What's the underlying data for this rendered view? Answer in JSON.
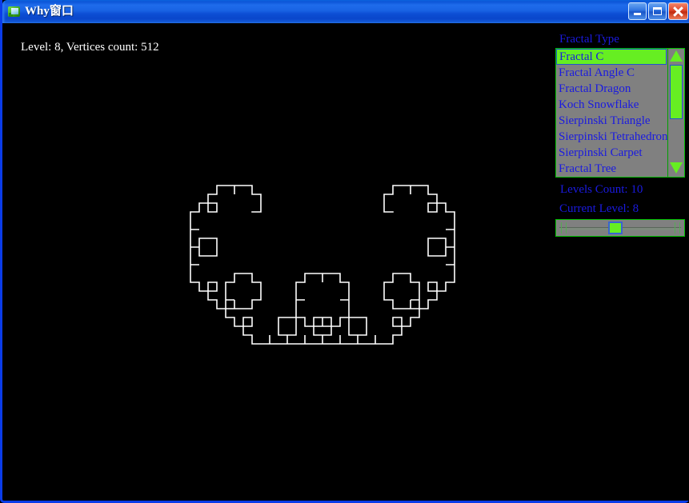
{
  "window": {
    "title": "Why窗口",
    "icon": "app-fractal-icon",
    "caption_buttons": {
      "minimize_label": "Minimize",
      "maximize_label": "Maximize",
      "close_label": "Close"
    }
  },
  "status": {
    "text": "Level: 8, Vertices count: 512",
    "level": 8,
    "vertices_count": 512,
    "color": "#ffffff"
  },
  "panel": {
    "fractal_type_label": "Fractal Type",
    "levels_count_label": "Levels Count: 10",
    "current_level_label": "Current Level: 8",
    "label_color": "#1a1ae0",
    "accent_color": "#66ee22",
    "control_background": "#808080"
  },
  "listbox": {
    "selected_index": 0,
    "items": [
      {
        "label": "Fractal C"
      },
      {
        "label": "Fractal Angle C"
      },
      {
        "label": "Fractal Dragon"
      },
      {
        "label": "Koch Snowflake"
      },
      {
        "label": "Sierpinski Triangle"
      },
      {
        "label": "Sierpinski Tetrahedron"
      },
      {
        "label": "Sierpinski Carpet"
      },
      {
        "label": "Fractal Tree"
      }
    ],
    "scrollbar": {
      "up_arrow_icon": "triangle-up-icon",
      "down_arrow_icon": "triangle-down-icon",
      "thumb_position_percent": 12
    }
  },
  "slider": {
    "min": 1,
    "max": 10,
    "value": 8,
    "thumb_percent": 45
  },
  "canvas": {
    "background": "#000000",
    "stroke_color": "#ffffff",
    "fractal_name": "Fractal C",
    "level": 8,
    "vertices": 512
  }
}
